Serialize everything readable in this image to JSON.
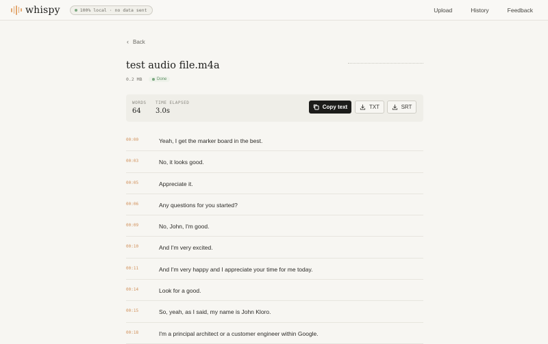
{
  "brand": {
    "name": "whispy",
    "badge": "100% local · no data sent"
  },
  "nav": {
    "items": [
      "Upload",
      "History",
      "Feedback"
    ]
  },
  "back_label": "Back",
  "file": {
    "title": "test audio file.m4a",
    "size": "0.2 MB",
    "status": "Done"
  },
  "stats": {
    "words_label": "WORDS",
    "words_value": "64",
    "time_label": "TIME ELAPSED",
    "time_value": "3.0s"
  },
  "actions": {
    "copy_label": "Copy text",
    "txt_label": "TXT",
    "srt_label": "SRT"
  },
  "transcript": [
    {
      "time": "00:00",
      "text": "Yeah, I get the marker board in the best."
    },
    {
      "time": "00:03",
      "text": "No, it looks good."
    },
    {
      "time": "00:05",
      "text": "Appreciate it."
    },
    {
      "time": "00:06",
      "text": "Any questions for you started?"
    },
    {
      "time": "00:09",
      "text": "No, John, I'm good."
    },
    {
      "time": "00:10",
      "text": "And I'm very excited."
    },
    {
      "time": "00:11",
      "text": "And I'm very happy and I appreciate your time for me today."
    },
    {
      "time": "00:14",
      "text": "Look for a good."
    },
    {
      "time": "00:15",
      "text": "So, yeah, as I said, my name is John Kloro."
    },
    {
      "time": "00:18",
      "text": "I'm a principal architect or a customer engineer within Google."
    }
  ],
  "colors": {
    "accent": "#d08f58",
    "status_green": "#5d8f63",
    "button_dark": "#1c1c1a"
  }
}
